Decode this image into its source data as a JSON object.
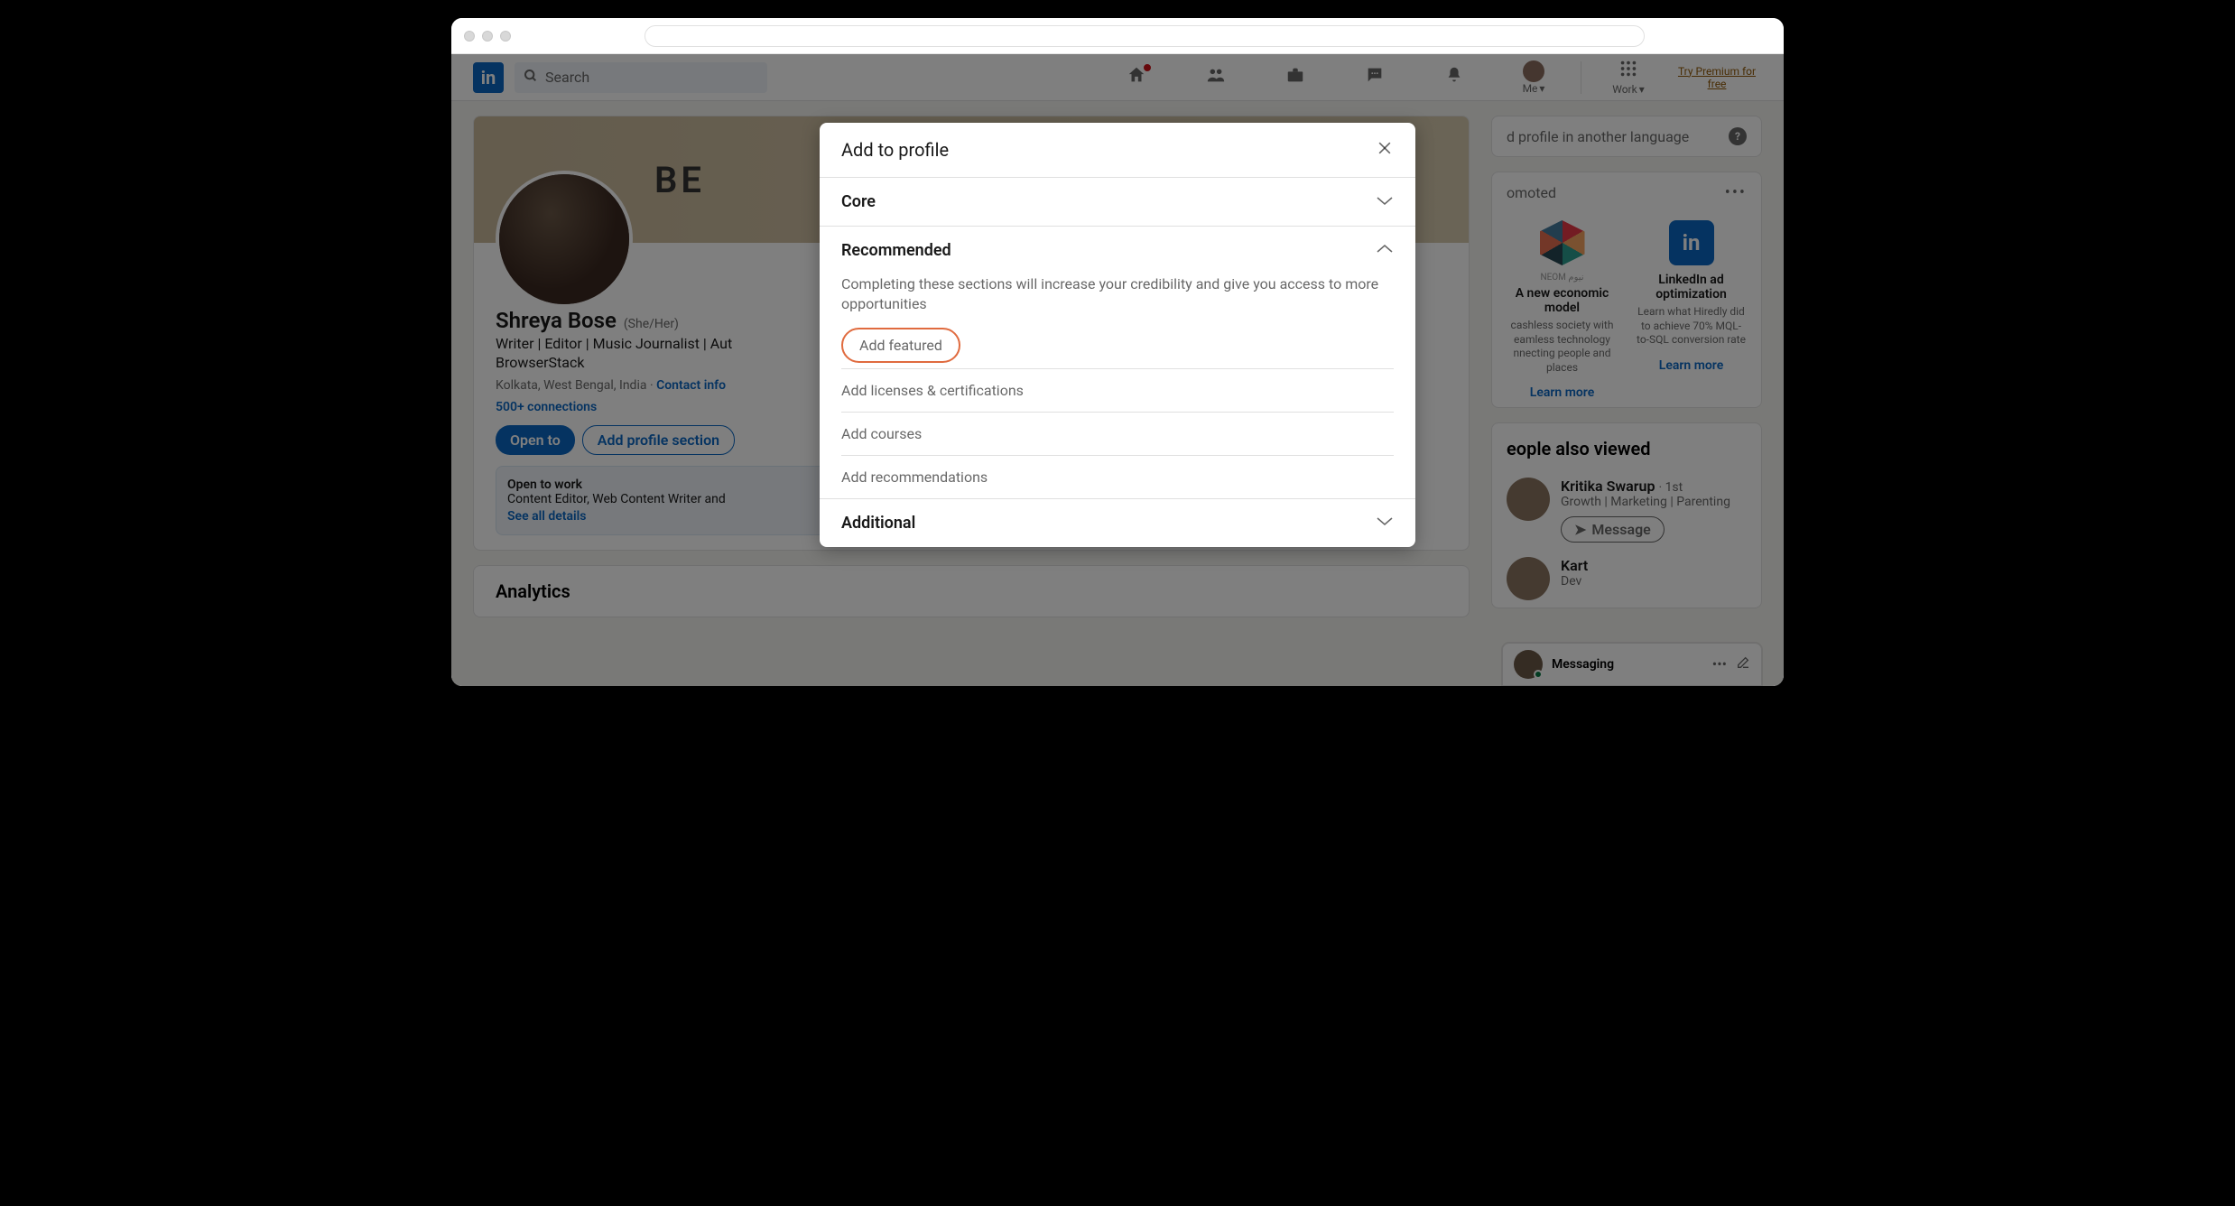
{
  "topnav": {
    "search_placeholder": "Search",
    "home": "Home",
    "network": "My Network",
    "jobs": "Jobs",
    "messaging": "Messaging",
    "notifications": "Notifications",
    "me": "Me",
    "work": "Work",
    "premium": "Try Premium for free"
  },
  "profile": {
    "cover_text": "BE",
    "name": "Shreya Bose",
    "pronouns": "(She/Her)",
    "headline": "Writer | Editor | Music Journalist | Aut",
    "headline2": "BrowserStack",
    "location": "Kolkata, West Bengal, India",
    "contact": "Contact info",
    "connections": "500+ connections",
    "open_to_btn": "Open to",
    "add_section_btn": "Add profile section",
    "otw_title": "Open to work",
    "otw_sub": "Content Editor, Web Content Writer and",
    "otw_link": "See all details"
  },
  "analytics": {
    "title": "Analytics"
  },
  "sidebar": {
    "lang_title": "d profile in another language",
    "promoted": "omoted",
    "promo1_title": "A new economic model",
    "promo1_desc": "cashless society with eamless technology nnecting people and places",
    "promo2_title": "LinkedIn ad optimization",
    "promo2_desc": "Learn what Hiredly did to achieve 70% MQL-to-SQL conversion rate",
    "learn_more": "Learn more",
    "pav_title": "eople also viewed",
    "pav1_name": "Kritika Swarup",
    "pav1_degree": "· 1st",
    "pav1_headline": "Growth | Marketing | Parenting",
    "pav2_name": "Kart",
    "pav2_headline": "Dev",
    "message_btn": "Message"
  },
  "modal": {
    "title": "Add to profile",
    "core": "Core",
    "recommended": "Recommended",
    "rec_desc": "Completing these sections will increase your credibility and give you access to more opportunities",
    "opt_featured": "Add featured",
    "opt_licenses": "Add licenses & certifications",
    "opt_courses": "Add courses",
    "opt_recommendations": "Add recommendations",
    "additional": "Additional"
  },
  "messaging": {
    "label": "Messaging"
  }
}
